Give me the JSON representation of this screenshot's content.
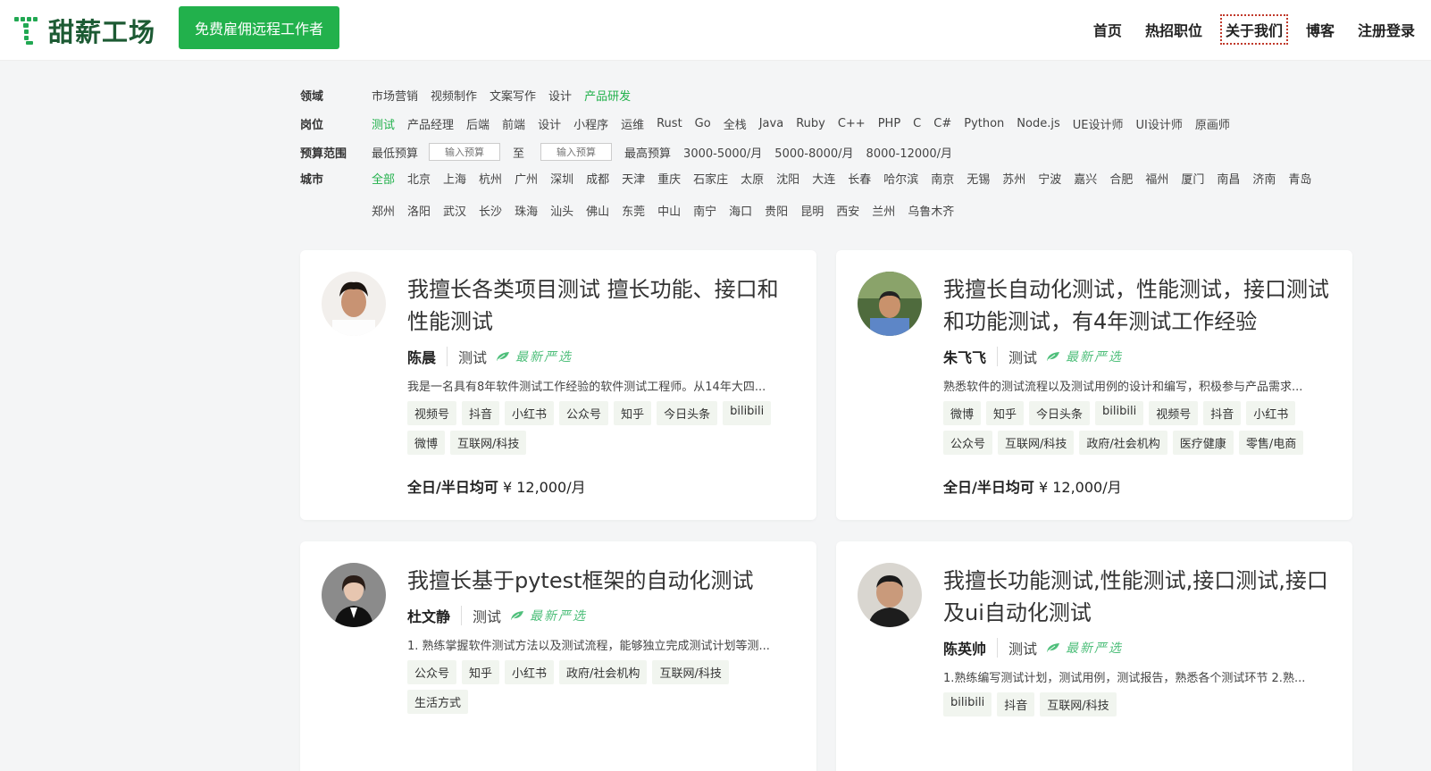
{
  "brand": {
    "name": "甜薪工场",
    "accent": "#22b14c"
  },
  "header": {
    "hire_button": "免费雇佣远程工作者",
    "nav": [
      {
        "label": "首页"
      },
      {
        "label": "热招职位"
      },
      {
        "label": "关于我们"
      },
      {
        "label": "博客"
      },
      {
        "label": "注册登录"
      }
    ]
  },
  "filters": {
    "domain": {
      "label": "领域",
      "options": [
        "市场营销",
        "视频制作",
        "文案写作",
        "设计",
        "产品研发"
      ],
      "active": "产品研发"
    },
    "position": {
      "label": "岗位",
      "options": [
        "测试",
        "产品经理",
        "后端",
        "前端",
        "设计",
        "小程序",
        "运维",
        "Rust",
        "Go",
        "全栈",
        "Java",
        "Ruby",
        "C++",
        "PHP",
        "C",
        "C#",
        "Python",
        "Node.js",
        "UE设计师",
        "UI设计师",
        "原画师"
      ],
      "active": "测试"
    },
    "budget": {
      "label": "预算范围",
      "min_label": "最低预算",
      "input_placeholder": "输入预算",
      "separator": "至",
      "max_label": "最高预算",
      "presets": [
        "3000-5000/月",
        "5000-8000/月",
        "8000-12000/月"
      ]
    },
    "city": {
      "label": "城市",
      "options": [
        "全部",
        "北京",
        "上海",
        "杭州",
        "广州",
        "深圳",
        "成都",
        "天津",
        "重庆",
        "石家庄",
        "太原",
        "沈阳",
        "大连",
        "长春",
        "哈尔滨",
        "南京",
        "无锡",
        "苏州",
        "宁波",
        "嘉兴",
        "合肥",
        "福州",
        "厦门",
        "南昌",
        "济南",
        "青岛",
        "郑州",
        "洛阳",
        "武汉",
        "长沙",
        "珠海",
        "汕头",
        "佛山",
        "东莞",
        "中山",
        "南宁",
        "海口",
        "贵阳",
        "昆明",
        "西安",
        "兰州",
        "乌鲁木齐"
      ],
      "active": "全部"
    }
  },
  "cards": [
    {
      "title": "我擅长各类项目测试 擅长功能、接口和性能测试",
      "name": "陈晨",
      "role": "测试",
      "badge": "最新严选",
      "desc": "我是一名具有8年软件测试工作经验的软件测试工程师。从14年大四...",
      "tags": [
        "视频号",
        "抖音",
        "小红书",
        "公众号",
        "知乎",
        "今日头条",
        "bilibili",
        "微博",
        "互联网/科技"
      ],
      "price_label": "全日/半日均可",
      "price": "¥ 12,000/月"
    },
    {
      "title": "我擅长自动化测试，性能测试，接口测试和功能测试，有4年测试工作经验",
      "name": "朱飞飞",
      "role": "测试",
      "badge": "最新严选",
      "desc": "熟悉软件的测试流程以及测试用例的设计和编写，积极参与产品需求...",
      "tags": [
        "微博",
        "知乎",
        "今日头条",
        "bilibili",
        "视频号",
        "抖音",
        "小红书",
        "公众号",
        "互联网/科技",
        "政府/社会机构",
        "医疗健康",
        "零售/电商"
      ],
      "price_label": "全日/半日均可",
      "price": "¥ 12,000/月"
    },
    {
      "title": "我擅长基于pytest框架的自动化测试",
      "name": "杜文静",
      "role": "测试",
      "badge": "最新严选",
      "desc": "1. 熟练掌握软件测试方法以及测试流程，能够独立完成测试计划等测...",
      "tags": [
        "公众号",
        "知乎",
        "小红书",
        "政府/社会机构",
        "互联网/科技",
        "生活方式"
      ]
    },
    {
      "title": "我擅长功能测试,性能测试,接口测试,接口及ui自动化测试",
      "name": "陈英帅",
      "role": "测试",
      "badge": "最新严选",
      "desc": "1.熟练编写测试计划，测试用例，测试报告，熟悉各个测试环节 2.熟...",
      "tags": [
        "bilibili",
        "抖音",
        "互联网/科技"
      ]
    }
  ]
}
